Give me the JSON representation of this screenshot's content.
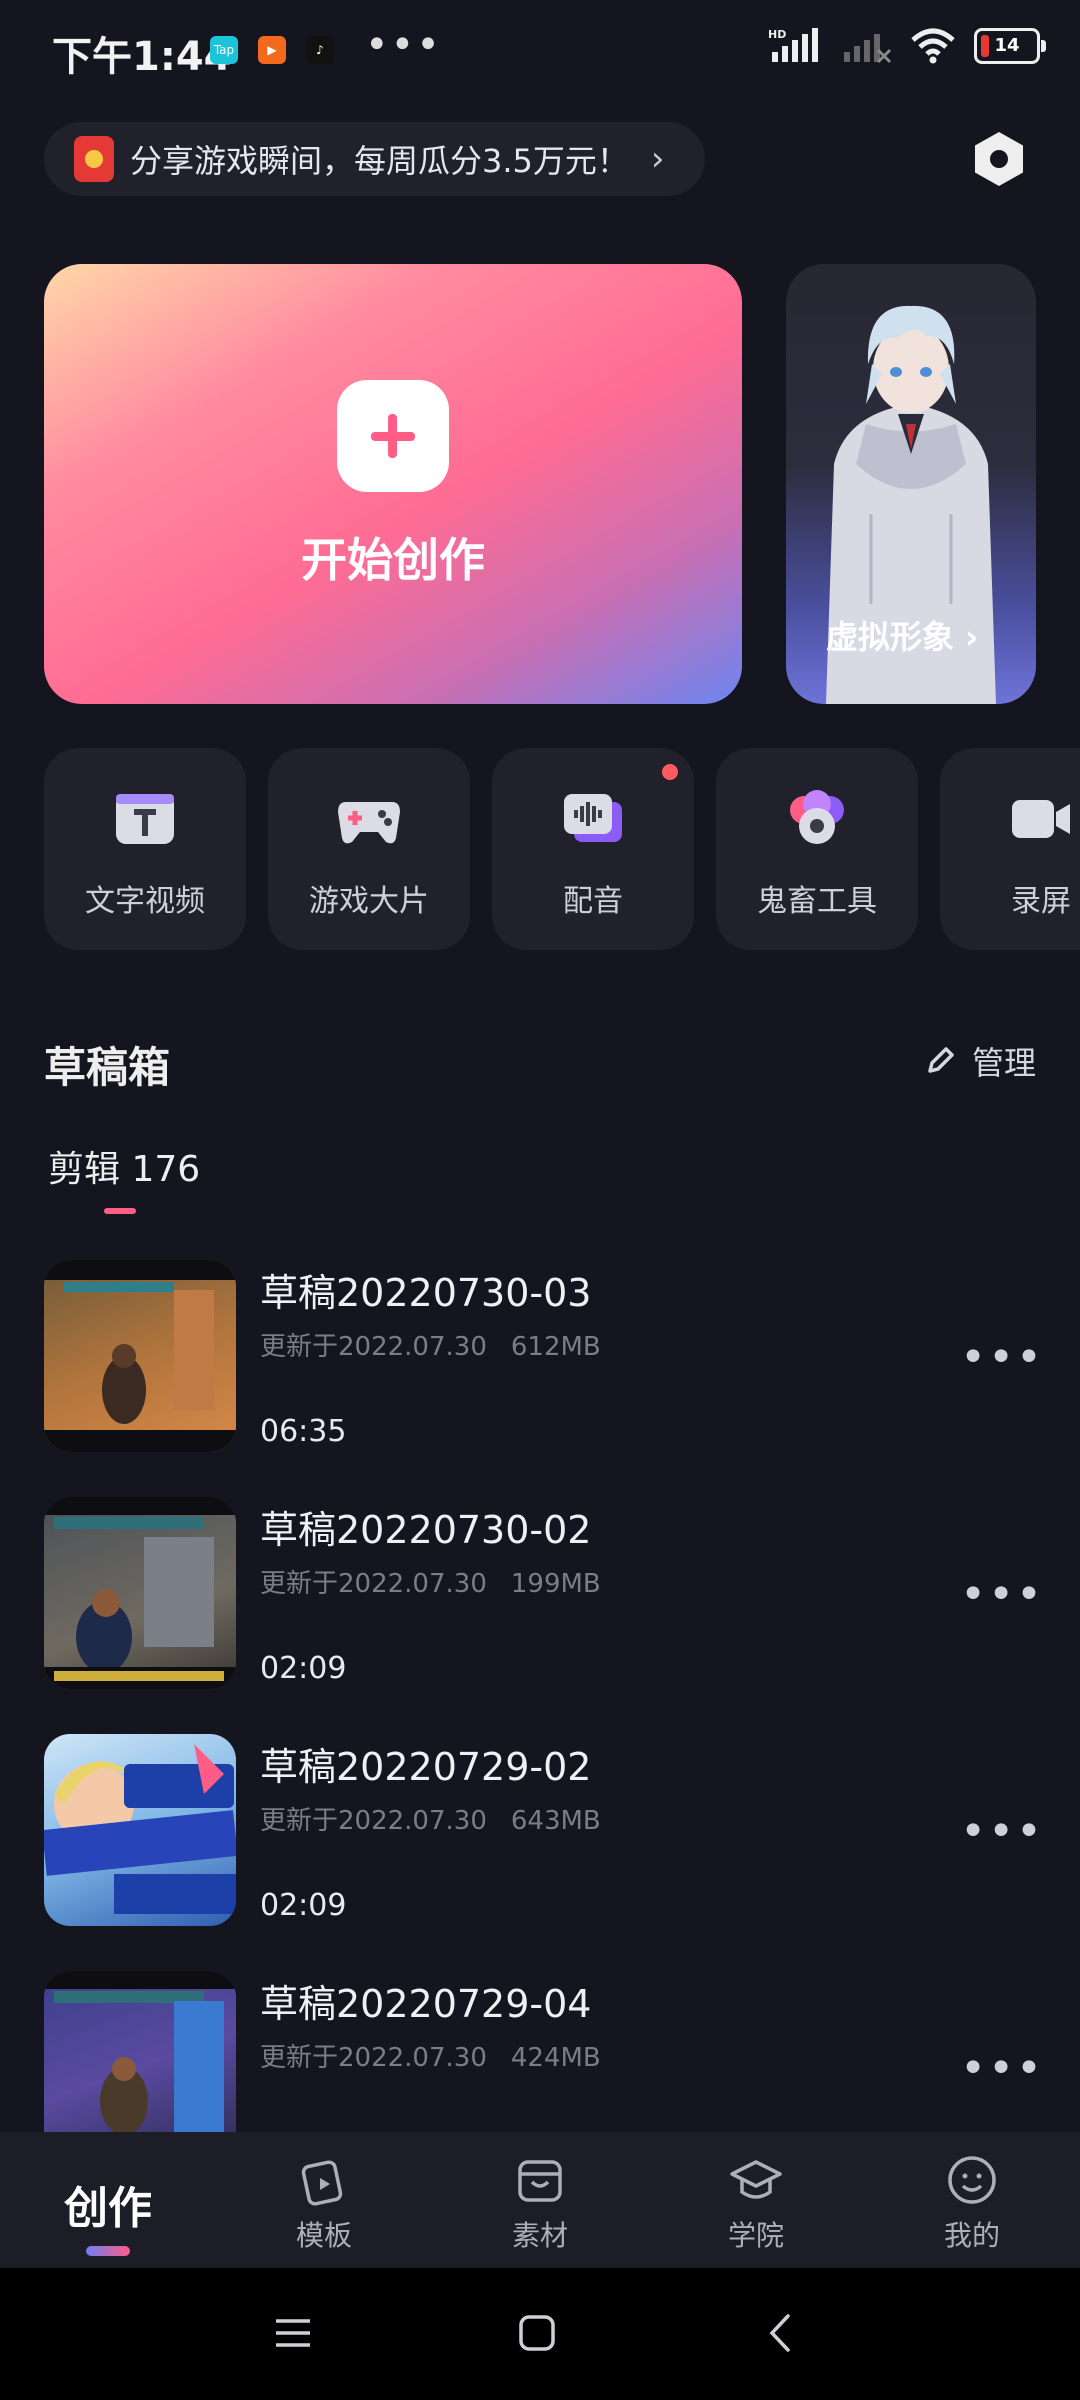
{
  "status_bar": {
    "time": "下午1:44",
    "apps": [
      {
        "name": "taptap-icon",
        "text": "Tap",
        "color": "#1bc4d8"
      },
      {
        "name": "camera-app-icon",
        "text": "▶",
        "color": "#f26b1d"
      },
      {
        "name": "tiktok-icon",
        "text": "♪",
        "color": "#111111"
      }
    ],
    "more": "•••",
    "network": "HD",
    "battery": "14"
  },
  "promo": {
    "text": "分享游戏瞬间，每周瓜分3.5万元！",
    "chevron": "›"
  },
  "hero": {
    "start_label": "开始创作",
    "avatar_label": "虚拟形象 ›"
  },
  "tools": [
    {
      "label": "文字视频",
      "icon": "text-video-icon"
    },
    {
      "label": "游戏大片",
      "icon": "gamepad-icon"
    },
    {
      "label": "配音",
      "icon": "voice-over-icon",
      "badge": true
    },
    {
      "label": "鬼畜工具",
      "icon": "meme-tool-icon"
    },
    {
      "label": "录屏",
      "icon": "screen-record-icon"
    }
  ],
  "drafts": {
    "title": "草稿箱",
    "manage_label": "管理",
    "tab_label": "剪辑 176",
    "items": [
      {
        "title": "草稿20220730-03",
        "updated": "更新于2022.07.30",
        "size": "612MB",
        "duration": "06:35"
      },
      {
        "title": "草稿20220730-02",
        "updated": "更新于2022.07.30",
        "size": "199MB",
        "duration": "02:09"
      },
      {
        "title": "草稿20220729-02",
        "updated": "更新于2022.07.30",
        "size": "643MB",
        "duration": "02:09"
      },
      {
        "title": "草稿20220729-04",
        "updated": "更新于2022.07.30",
        "size": "424MB",
        "duration": ""
      }
    ]
  },
  "bottom_nav": [
    {
      "label": "创作",
      "active": true
    },
    {
      "label": "模板",
      "icon": "template-icon"
    },
    {
      "label": "素材",
      "icon": "material-store-icon"
    },
    {
      "label": "学院",
      "icon": "academy-icon"
    },
    {
      "label": "我的",
      "icon": "profile-smile-icon"
    }
  ],
  "colors": {
    "background": "#15151f",
    "accent_pink": "#ff5c86",
    "accent_blue": "#6f7df2",
    "card": "#21212c"
  }
}
